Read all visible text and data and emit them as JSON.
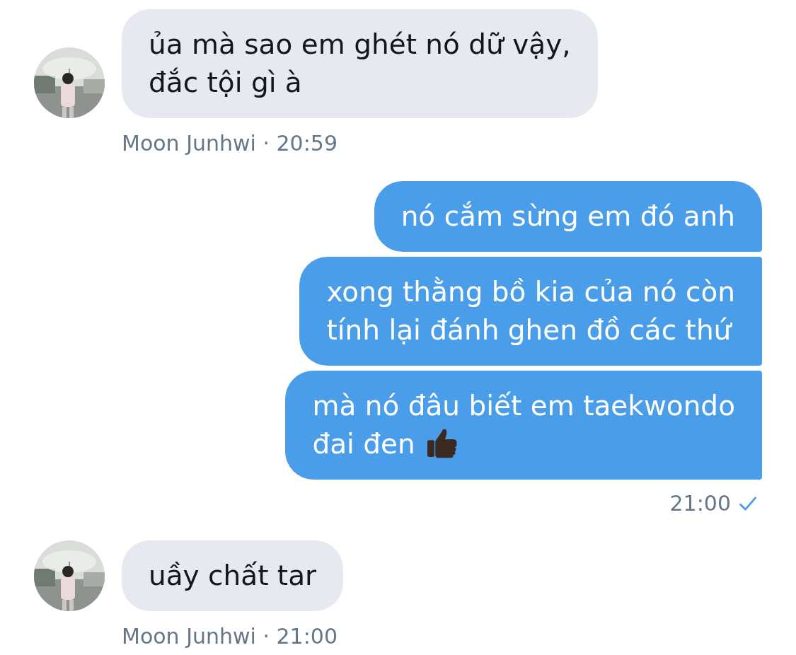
{
  "messages": [
    {
      "kind": "incoming",
      "bubbles": [
        {
          "text": "ủa mà sao em ghét nó dữ vậy,\nđắc tội gì à"
        }
      ],
      "meta": "Moon Junhwi · 20:59"
    },
    {
      "kind": "outgoing",
      "bubbles": [
        {
          "text": "nó cắm sừng em đó anh"
        },
        {
          "text": "xong thằng bồ kia của nó còn\ntính lại đánh ghen đồ các thứ"
        },
        {
          "text": "mà nó đâu biết em taekwondo\nđai đen",
          "thumbs_up": true
        }
      ],
      "meta": "21:00",
      "delivered": true
    },
    {
      "kind": "incoming",
      "bubbles": [
        {
          "text": "uầy chất tar"
        }
      ],
      "meta": "Moon Junhwi · 21:00"
    }
  ]
}
